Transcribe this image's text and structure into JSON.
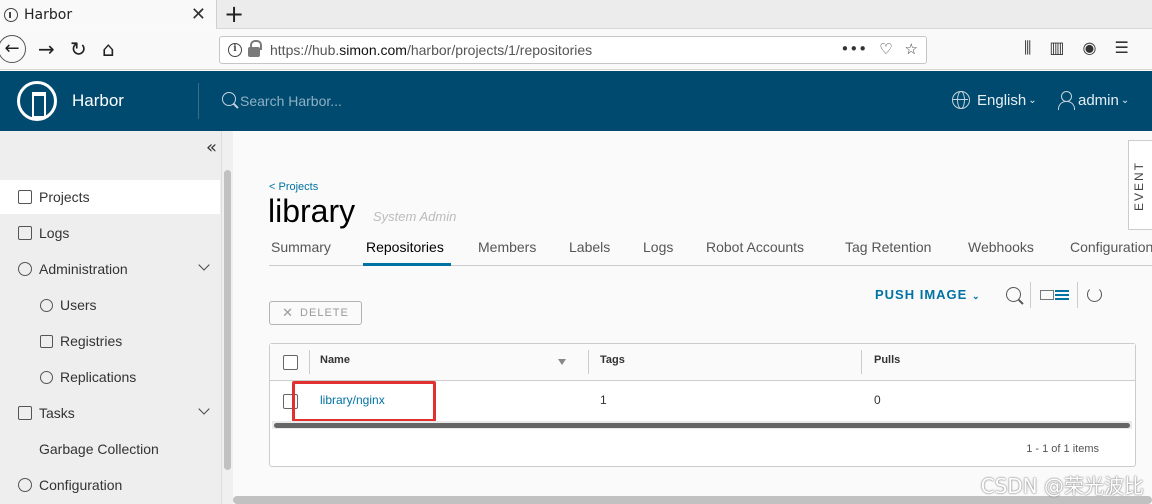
{
  "browser": {
    "tab_title": "Harbor",
    "tab_close": "✕",
    "new_tab": "+",
    "url_prefix": "https://hub.",
    "url_domain": "simon.com",
    "url_path": "/harbor/projects/1/repositories",
    "url_actions": "•••"
  },
  "header": {
    "brand": "Harbor",
    "search_placeholder": "Search Harbor...",
    "language": "English",
    "user": "admin"
  },
  "sidebar": {
    "collapse": "«",
    "items": [
      {
        "label": "Projects"
      },
      {
        "label": "Logs"
      },
      {
        "label": "Administration"
      },
      {
        "label": "Users"
      },
      {
        "label": "Registries"
      },
      {
        "label": "Replications"
      },
      {
        "label": "Tasks"
      },
      {
        "label": "Garbage Collection"
      },
      {
        "label": "Configuration"
      }
    ]
  },
  "project": {
    "back_link": "< Projects",
    "name": "library",
    "role": "System Admin",
    "tabs": [
      "Summary",
      "Repositories",
      "Members",
      "Labels",
      "Logs",
      "Robot Accounts",
      "Tag Retention",
      "Webhooks",
      "Configuration"
    ],
    "active_tab": "Repositories"
  },
  "toolbar": {
    "push_image": "PUSH IMAGE",
    "delete": "DELETE"
  },
  "table": {
    "columns": [
      "Name",
      "Tags",
      "Pulls"
    ],
    "rows": [
      {
        "name": "library/nginx",
        "tags": "1",
        "pulls": "0"
      }
    ],
    "footer": "1 - 1 of 1 items"
  },
  "event_tab": "EVENT",
  "watermark": "CSDN @荣光波比",
  "colors": {
    "header_bg": "#004a70",
    "accent": "#0072a3",
    "highlight": "#e03030"
  }
}
